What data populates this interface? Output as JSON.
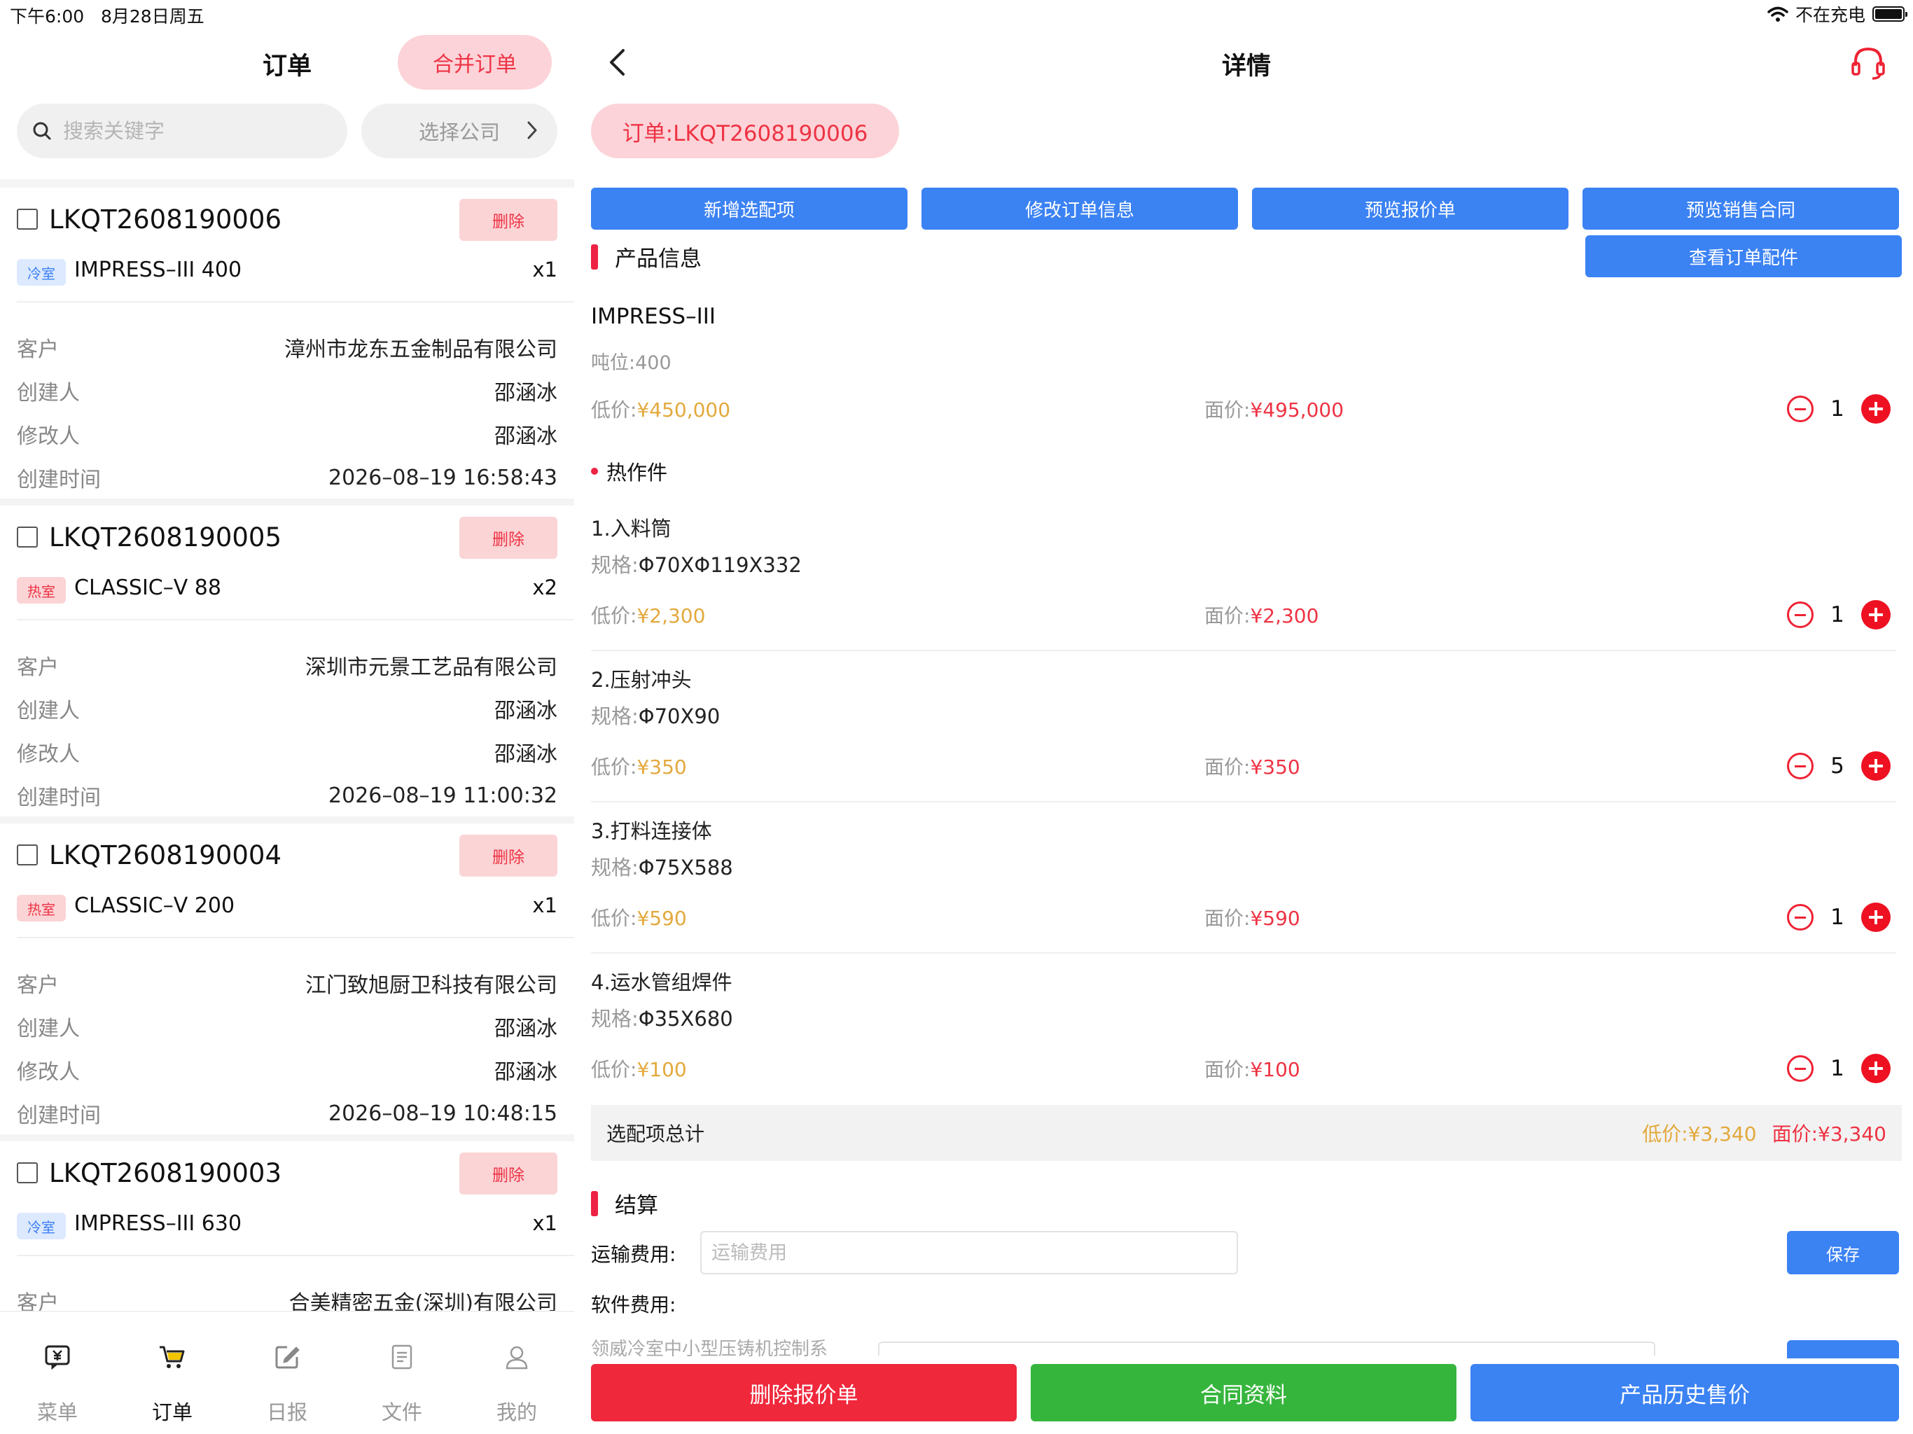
{
  "status_bar": {
    "time": "下午6:00",
    "date": "8月28日周五",
    "charging": "不在充电"
  },
  "orders_pane": {
    "title": "订单",
    "merge_button": "合并订单",
    "search_placeholder": "搜索关键字",
    "company_select": "选择公司",
    "orders": [
      {
        "id": "LKQT2608190006",
        "delete_label": "删除",
        "tag": "冷室",
        "tag_type": "cold",
        "model": "IMPRESS–III  400",
        "qty": "x1",
        "fields": [
          {
            "k": "客户",
            "v": "漳州市龙东五金制品有限公司"
          },
          {
            "k": "创建人",
            "v": "邵涵冰"
          },
          {
            "k": "修改人",
            "v": "邵涵冰"
          },
          {
            "k": "创建时间",
            "v": "2026–08–19 16:58:43"
          }
        ]
      },
      {
        "id": "LKQT2608190005",
        "delete_label": "删除",
        "tag": "热室",
        "tag_type": "hot",
        "model": "CLASSIC–V  88",
        "qty": "x2",
        "fields": [
          {
            "k": "客户",
            "v": "深圳市元景工艺品有限公司"
          },
          {
            "k": "创建人",
            "v": "邵涵冰"
          },
          {
            "k": "修改人",
            "v": "邵涵冰"
          },
          {
            "k": "创建时间",
            "v": "2026–08–19 11:00:32"
          }
        ]
      },
      {
        "id": "LKQT2608190004",
        "delete_label": "删除",
        "tag": "热室",
        "tag_type": "hot",
        "model": "CLASSIC–V  200",
        "qty": "x1",
        "fields": [
          {
            "k": "客户",
            "v": "江门致旭厨卫科技有限公司"
          },
          {
            "k": "创建人",
            "v": "邵涵冰"
          },
          {
            "k": "修改人",
            "v": "邵涵冰"
          },
          {
            "k": "创建时间",
            "v": "2026–08–19 10:48:15"
          }
        ]
      },
      {
        "id": "LKQT2608190003",
        "delete_label": "删除",
        "tag": "冷室",
        "tag_type": "cold",
        "model": "IMPRESS–III  630",
        "qty": "x1",
        "fields": [
          {
            "k": "客户",
            "v": "合美精密五金(深圳)有限公司"
          }
        ]
      }
    ],
    "tabs": [
      {
        "label": "菜单",
        "icon": "menu-yen-icon",
        "active": false
      },
      {
        "label": "订单",
        "icon": "cart-icon",
        "active": true
      },
      {
        "label": "日报",
        "icon": "edit-icon",
        "active": false
      },
      {
        "label": "文件",
        "icon": "document-icon",
        "active": false
      },
      {
        "label": "我的",
        "icon": "user-icon",
        "active": false
      }
    ]
  },
  "detail_pane": {
    "title": "详情",
    "order_label": "订单:LKQT2608190006",
    "actions": {
      "add_option": "新增选配项",
      "edit_order": "修改订单信息",
      "preview_quote": "预览报价单",
      "preview_contract": "预览销售合同",
      "view_parts": "查看订单配件"
    },
    "product_section": "产品信息",
    "product": {
      "name": "IMPRESS–III",
      "tonnage_label": "吨位:",
      "tonnage": "400",
      "low_label": "低价:",
      "low_price": "¥450,000",
      "face_label": "面价:",
      "face_price": "¥495,000",
      "qty": "1"
    },
    "hot_parts_title": "热作件",
    "parts": [
      {
        "name": "1.入料筒",
        "spec_label": "规格:",
        "spec": "Φ70XΦ119X332",
        "low_label": "低价:",
        "low": "¥2,300",
        "face_label": "面价:",
        "face": "¥2,300",
        "qty": "1"
      },
      {
        "name": "2.压射冲头",
        "spec_label": "规格:",
        "spec": "Φ70X90",
        "low_label": "低价:",
        "low": "¥350",
        "face_label": "面价:",
        "face": "¥350",
        "qty": "5"
      },
      {
        "name": "3.打料连接体",
        "spec_label": "规格:",
        "spec": "Φ75X588",
        "low_label": "低价:",
        "low": "¥590",
        "face_label": "面价:",
        "face": "¥590",
        "qty": "1"
      },
      {
        "name": "4.运水管组焊件",
        "spec_label": "规格:",
        "spec": "Φ35X680",
        "low_label": "低价:",
        "low": "¥100",
        "face_label": "面价:",
        "face": "¥100",
        "qty": "1"
      }
    ],
    "options_total": {
      "label": "选配项总计",
      "low": "低价:¥3,340",
      "face": "面价:¥3,340"
    },
    "settlement_section": "结算",
    "shipping_label": "运输费用:",
    "shipping_placeholder": "运输费用",
    "save_label": "保存",
    "software_label": "软件费用:",
    "software_item": "领威冷室中小型压铸机控制系",
    "bottom_buttons": {
      "delete_quote": "删除报价单",
      "contract_docs": "合同资料",
      "price_history": "产品历史售价"
    },
    "colors": {
      "primary_blue": "#3b82f3",
      "danger_red": "#f0283c",
      "success_green": "#36b53d",
      "low_price_orange": "#e3a93d",
      "face_price_red": "#ee3344"
    }
  }
}
